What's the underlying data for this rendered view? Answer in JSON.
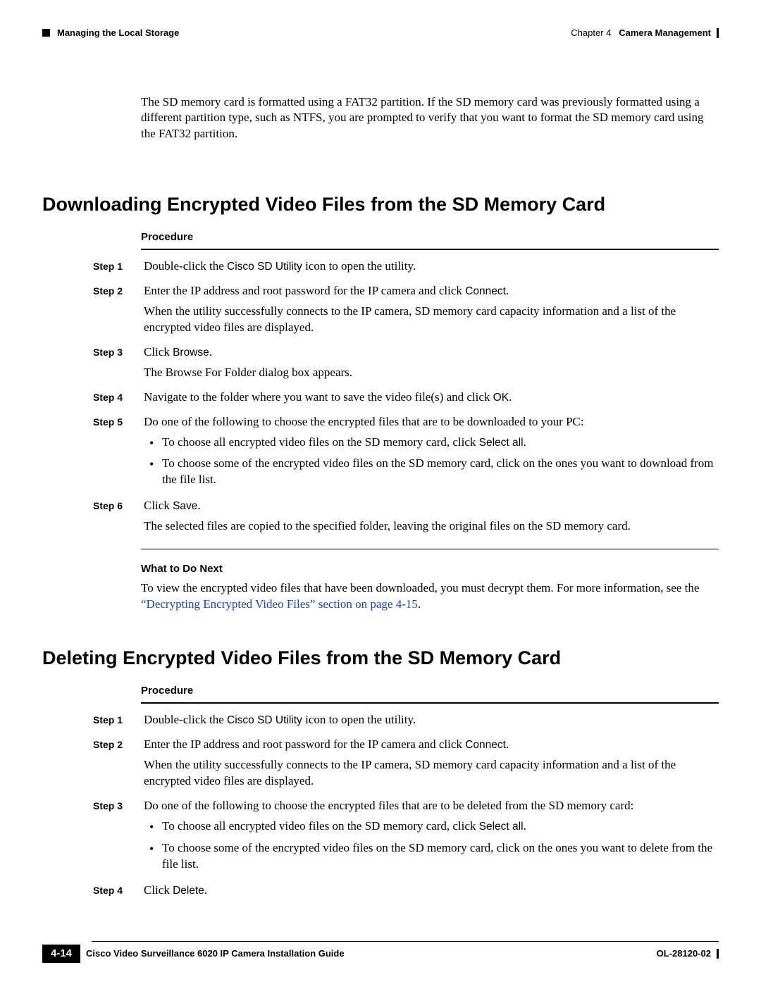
{
  "header": {
    "section_running": "Managing the Local Storage",
    "chapter_prefix": "Chapter 4",
    "chapter_title": "Camera Management"
  },
  "intro_paragraph": "The SD memory card is formatted using a FAT32 partition. If the SD memory card was previously formatted using a different partition type, such as NTFS, you are prompted to verify that you want to format the SD memory card using the FAT32 partition.",
  "section1": {
    "title": "Downloading Encrypted Video Files from the SD Memory Card",
    "procedure_label": "Procedure",
    "steps": [
      {
        "label": "Step 1",
        "text_pre": "Double-click the ",
        "ui": "Cisco SD Utility",
        "text_post": " icon to open the utility."
      },
      {
        "label": "Step 2",
        "line1_pre": "Enter the IP address and root password for the IP camera and click ",
        "line1_ui": "Connect",
        "line1_post": ".",
        "line2": "When the utility successfully connects to the IP camera, SD memory card capacity information and a list of the encrypted video files are displayed."
      },
      {
        "label": "Step 3",
        "line1_pre": "Click ",
        "line1_ui": "Browse",
        "line1_post": ".",
        "line2": "The Browse For Folder dialog box appears."
      },
      {
        "label": "Step 4",
        "text_pre": "Navigate to the folder where you want to save the video file(s) and click ",
        "ui": "OK",
        "text_post": "."
      },
      {
        "label": "Step 5",
        "lead": "Do one of the following to choose the encrypted files that are to be downloaded to your PC:",
        "bullets": [
          {
            "pre": "To choose all encrypted video files on the SD memory card, click ",
            "ui": "Select all",
            "post": "."
          },
          {
            "pre": "To choose some of the encrypted video files on the SD memory card, click on the ones you want to download from the file list.",
            "ui": "",
            "post": ""
          }
        ]
      },
      {
        "label": "Step 6",
        "line1_pre": "Click ",
        "line1_ui": "Save",
        "line1_post": ".",
        "line2": "The selected files are copied to the specified folder, leaving the original files on the SD memory card."
      }
    ],
    "what_next_heading": "What to Do Next",
    "what_next_text_pre": "To view the encrypted video files that have been downloaded, you must decrypt them. For more information, see the ",
    "what_next_link": "“Decrypting Encrypted Video Files” section on page 4-15",
    "what_next_text_post": "."
  },
  "section2": {
    "title": "Deleting Encrypted Video Files from the SD Memory Card",
    "procedure_label": "Procedure",
    "steps": [
      {
        "label": "Step 1",
        "text_pre": "Double-click the ",
        "ui": "Cisco SD Utility",
        "text_post": " icon to open the utility."
      },
      {
        "label": "Step 2",
        "line1_pre": "Enter the IP address and root password for the IP camera and click ",
        "line1_ui": "Connect",
        "line1_post": ".",
        "line2": "When the utility successfully connects to the IP camera, SD memory card capacity information and a list of the encrypted video files are displayed."
      },
      {
        "label": "Step 3",
        "lead": "Do one of the following to choose the encrypted files that are to be deleted from the SD memory card:",
        "bullets": [
          {
            "pre": "To choose all encrypted video files on the SD memory card, click ",
            "ui": "Select all",
            "post": "."
          },
          {
            "pre": "To choose some of the encrypted video files on the SD memory card, click on the ones you want to delete from the file list.",
            "ui": "",
            "post": ""
          }
        ]
      },
      {
        "label": "Step 4",
        "line1_pre": "Click ",
        "line1_ui": "Delete",
        "line1_post": "."
      }
    ]
  },
  "footer": {
    "book_title": "Cisco Video Surveillance 6020 IP Camera Installation Guide",
    "page_number": "4-14",
    "doc_id": "OL-28120-02"
  }
}
